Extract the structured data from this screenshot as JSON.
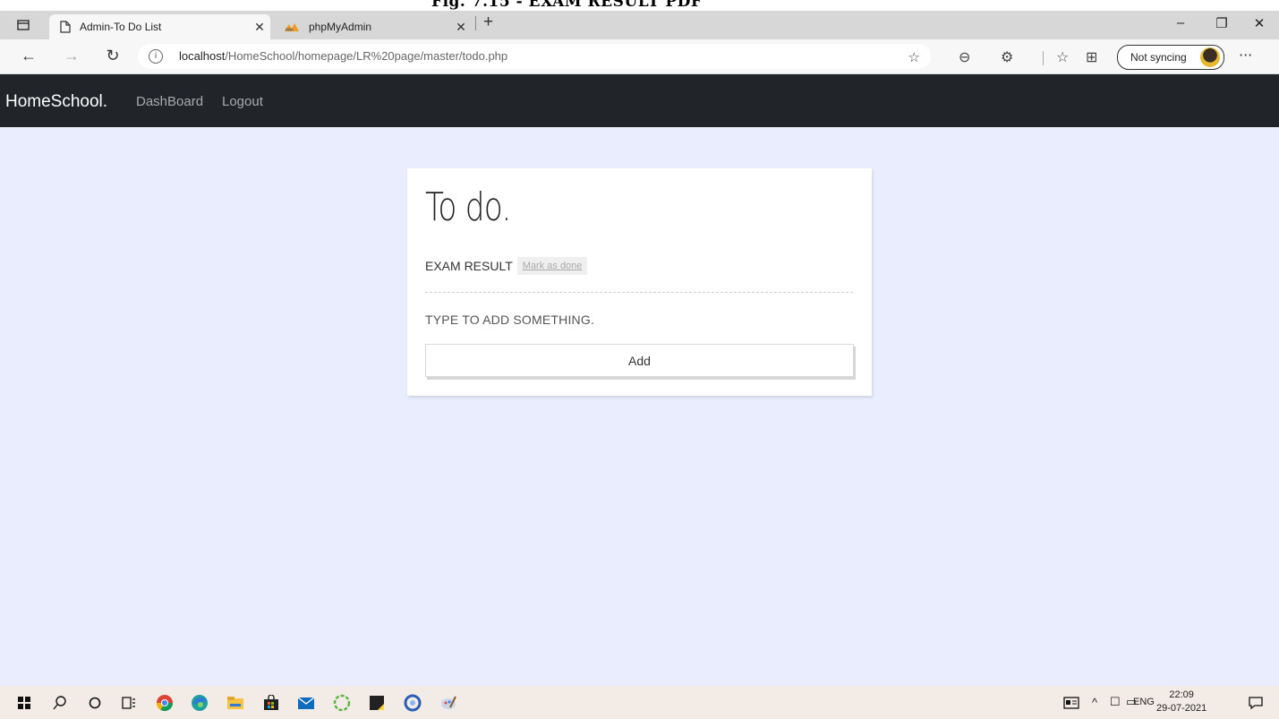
{
  "doc_caption": "Fig. 7.15 - EXAM RESULT PDF",
  "browser": {
    "tabs": [
      {
        "title": "Admin-To Do List",
        "active": true,
        "icon": "page-icon"
      },
      {
        "title": "phpMyAdmin",
        "active": false,
        "icon": "phpmyadmin-icon"
      }
    ],
    "close_glyph": "✕",
    "new_tab_glyph": "+",
    "window_controls": {
      "minimize": "–",
      "restore": "❐",
      "close": "✕"
    },
    "nav": {
      "back": "←",
      "forward": "→",
      "reload": "↻"
    },
    "url_host": "localhost",
    "url_path": "/HomeSchool/homepage/LR%20page/master/todo.php",
    "info_glyph": "i",
    "profile_status": "Not syncing",
    "more_glyph": "···"
  },
  "app": {
    "brand": "HomeSchool.",
    "nav_links": [
      "DashBoard",
      "Logout"
    ]
  },
  "todo": {
    "title": "To do.",
    "items": [
      {
        "text": "EXAM RESULT",
        "action": "Mark as done"
      }
    ],
    "add_placeholder": "TYPE TO ADD SOMETHING.",
    "add_button": "Add"
  },
  "taskbar": {
    "language": "ENG",
    "time": "22:09",
    "date": "29-07-2021"
  },
  "colors": {
    "navbar_bg": "#212529",
    "page_bg": "#eaedfd",
    "tabstrip_bg": "#d7d7d7",
    "taskbar_bg": "#f2ebe6"
  }
}
